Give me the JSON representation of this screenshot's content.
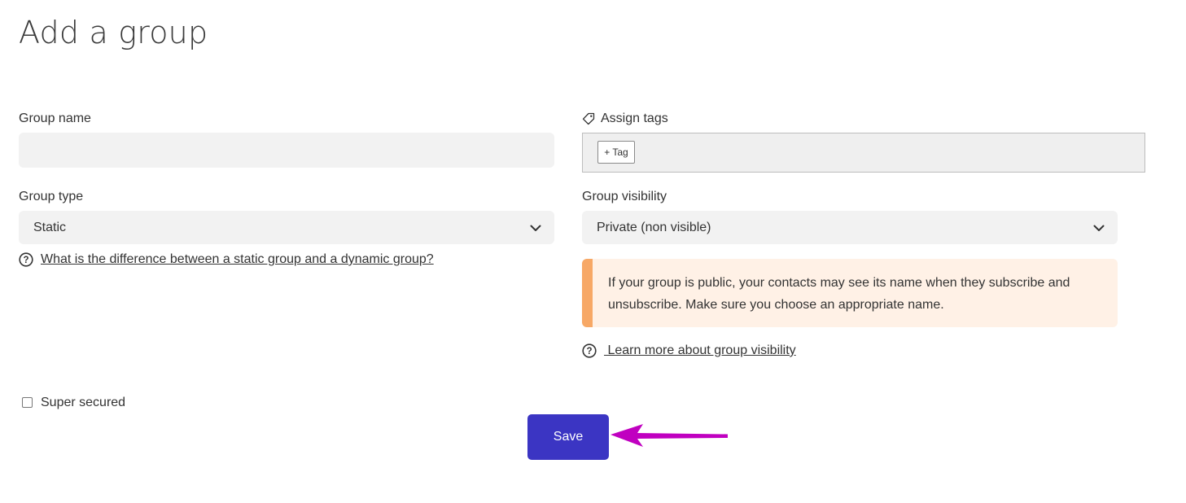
{
  "page": {
    "title": "Add a group"
  },
  "group_name": {
    "label": "Group name",
    "value": "",
    "placeholder": ""
  },
  "tags": {
    "label": "Assign tags",
    "add_button": "+ Tag",
    "icon": "tag-icon"
  },
  "group_type": {
    "label": "Group type",
    "selected": "Static",
    "help_link": "What is the difference between a static group and a dynamic group?"
  },
  "group_visibility": {
    "label": "Group visibility",
    "selected": "Private (non visible)",
    "alert_text": "If your group is public, your contacts may see its name when they subscribe and unsubscribe. Make sure you choose an appropriate name.",
    "help_link": " Learn more about group visibility"
  },
  "super_secured": {
    "label": "Super secured",
    "checked": false
  },
  "actions": {
    "save_label": "Save"
  },
  "colors": {
    "primary_button": "#3b35c3",
    "alert_accent": "#f7a866",
    "alert_background": "#fff1e6",
    "field_background": "#f2f2f2",
    "annotation_arrow": "#c000c0"
  }
}
